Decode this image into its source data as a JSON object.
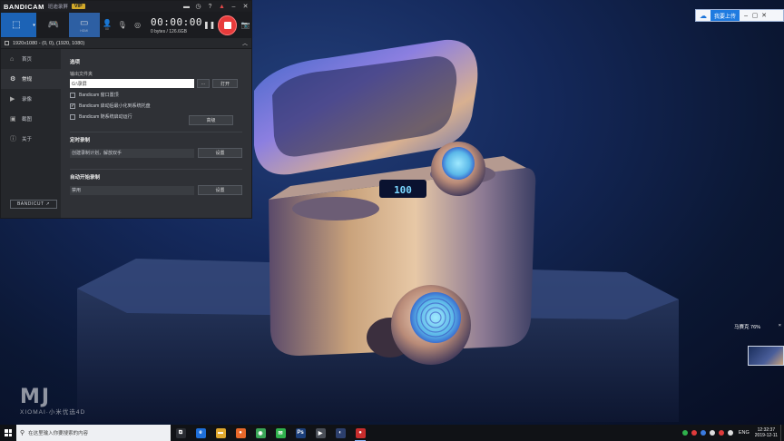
{
  "bandicam": {
    "brand": "BANDICAM",
    "brand_sub": "班迪录屏",
    "vip": "VIP",
    "titlebar_icons": [
      "folder-icon",
      "clock-icon",
      "help-icon",
      "alert-icon",
      "minimize-icon",
      "close-icon"
    ],
    "modes": [
      {
        "name": "screen-rect-mode",
        "icon": "⬚",
        "active": true
      },
      {
        "name": "game-mode",
        "icon": "🎮"
      },
      {
        "name": "device-mode",
        "icon": "▭",
        "sublabel": "HDMI"
      }
    ],
    "tools": [
      {
        "name": "webcam-tool",
        "icon": "👤",
        "mini": "00"
      },
      {
        "name": "mic-tool",
        "icon": "🎙",
        "mini": ""
      },
      {
        "name": "speaker-tool",
        "icon": "◎",
        "mini": ""
      }
    ],
    "timer": "00:00:00",
    "size": "0 bytes / 126.6GB",
    "target": "1920x1080 - (0, 0), (1920, 1080)",
    "nav": [
      {
        "name": "nav-home",
        "icon": "⌂",
        "label": "首页"
      },
      {
        "name": "nav-general",
        "icon": "⚙",
        "label": "常规",
        "active": true
      },
      {
        "name": "nav-video",
        "icon": "▶",
        "label": "录像"
      },
      {
        "name": "nav-image",
        "icon": "▣",
        "label": "截图"
      },
      {
        "name": "nav-about",
        "icon": "ⓘ",
        "label": "关于"
      }
    ],
    "bandicut": "BANDICUT ↗",
    "general": {
      "section_title": "选项",
      "output_label": "输出文件夹",
      "output_value": "G:\\录屏",
      "browse": "...",
      "open": "打开",
      "options": [
        {
          "label": "Bandicam 窗口置顶",
          "checked": false
        },
        {
          "label": "Bandicam 启动后最小化到系统托盘",
          "checked": true
        },
        {
          "label": "Bandicam 随系统启动运行",
          "checked": false
        }
      ],
      "advanced": "高级",
      "timer_title": "定时录制",
      "timer_value": "创建录制计划，解放双手",
      "timer_btn": "设置",
      "auto_title": "自动开始录制",
      "auto_value": "禁用",
      "auto_btn": "设置"
    }
  },
  "top_right_bar": {
    "upload": "我要上传",
    "system_icons": [
      "minimize-icon",
      "restore-icon",
      "close-icon"
    ]
  },
  "side_notification": {
    "title": "马赛克 76%",
    "close": "×"
  },
  "watermark": {
    "logo": "MJ",
    "text": "XIOMAI·小米优选4D"
  },
  "taskbar": {
    "search_placeholder": "在这里输入你要搜索的内容",
    "apps": [
      {
        "name": "task-view-app",
        "glyph": "⧉",
        "color": "#2a2d33"
      },
      {
        "name": "edge-app",
        "glyph": "e",
        "color": "#1e6fd9"
      },
      {
        "name": "folder-app",
        "glyph": "▬",
        "color": "#e0a82e"
      },
      {
        "name": "firefox-app",
        "glyph": "●",
        "color": "#e8682a"
      },
      {
        "name": "chrome-app",
        "glyph": "◉",
        "color": "#3aa757"
      },
      {
        "name": "wechat-app",
        "glyph": "✉",
        "color": "#2fb24c"
      },
      {
        "name": "photoshop-app",
        "glyph": "Ps",
        "color": "#1c3f7a"
      },
      {
        "name": "media-app",
        "glyph": "▶",
        "color": "#4a4f58"
      },
      {
        "name": "obs-app",
        "glyph": "◐",
        "color": "#2c3f6d"
      },
      {
        "name": "bandicam-app",
        "glyph": "●",
        "color": "#c82d2d",
        "running": true
      }
    ],
    "tray_colors": [
      "#2fb24c",
      "#e03b3b",
      "#3a7be0",
      "#ddd",
      "#e03b3b",
      "#ddd"
    ],
    "lang": "ENG",
    "time": "12:32:37",
    "date": "2019-12-11"
  }
}
